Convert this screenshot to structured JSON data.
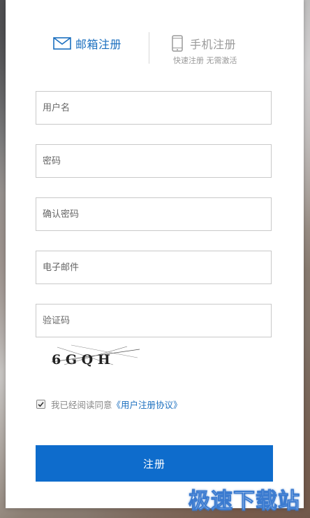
{
  "tabs": {
    "email_label": "邮箱注册",
    "phone_label": "手机注册",
    "phone_sub": "快速注册 无需激活"
  },
  "form": {
    "username_placeholder": "用户名",
    "password_placeholder": "密码",
    "confirm_placeholder": "确认密码",
    "email_placeholder": "电子邮件",
    "captcha_placeholder": "验证码",
    "captcha_text": "6 G Q H"
  },
  "agreement": {
    "checked": true,
    "text": "我已经阅读同意",
    "link": "《用户注册协议》"
  },
  "submit_label": "注册",
  "watermark": "极速下载站",
  "colors": {
    "accent": "#0e6ccc",
    "link": "#1b6fbf",
    "muted": "#999999"
  },
  "icons": {
    "email_tab": "envelope-icon",
    "phone_tab": "phone-icon",
    "checkbox": "check-icon"
  }
}
